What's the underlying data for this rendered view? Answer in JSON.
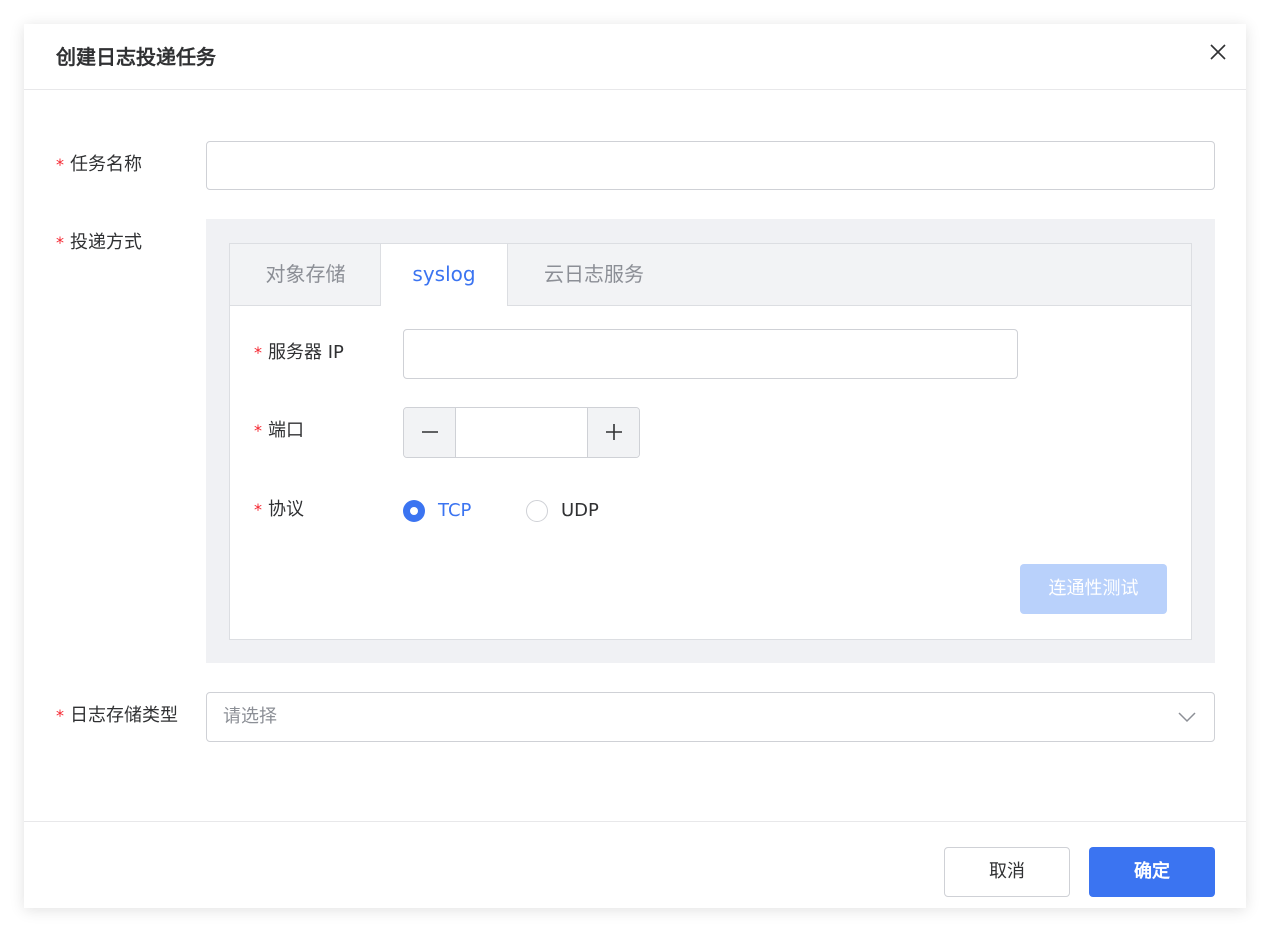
{
  "dialog": {
    "title": "创建日志投递任务"
  },
  "form": {
    "required_mark": "*",
    "task_name": {
      "label": "任务名称",
      "value": "",
      "placeholder": ""
    },
    "delivery_method": {
      "label": "投递方式",
      "tabs": [
        "对象存储",
        "syslog",
        "云日志服务"
      ],
      "active_tab": "syslog",
      "server_ip": {
        "label": "服务器 IP",
        "value": ""
      },
      "port": {
        "label": "端口",
        "value": "",
        "minus_symbol": "—",
        "plus_symbol": "+"
      },
      "protocol": {
        "label": "协议",
        "options": [
          "TCP",
          "UDP"
        ],
        "selected": "TCP"
      },
      "test_button": "连通性测试"
    },
    "log_storage_type": {
      "label": "日志存储类型",
      "placeholder": "请选择"
    }
  },
  "footer": {
    "cancel_label": "取消",
    "ok_label": "确定"
  },
  "icons": {
    "close": "close-icon",
    "dropdown": "chevron-down-icon"
  },
  "colors": {
    "primary": "#3b74f1",
    "primary_disabled": "#b9d1fb",
    "required": "#f5222d",
    "panel_bg": "#f0f1f4"
  }
}
